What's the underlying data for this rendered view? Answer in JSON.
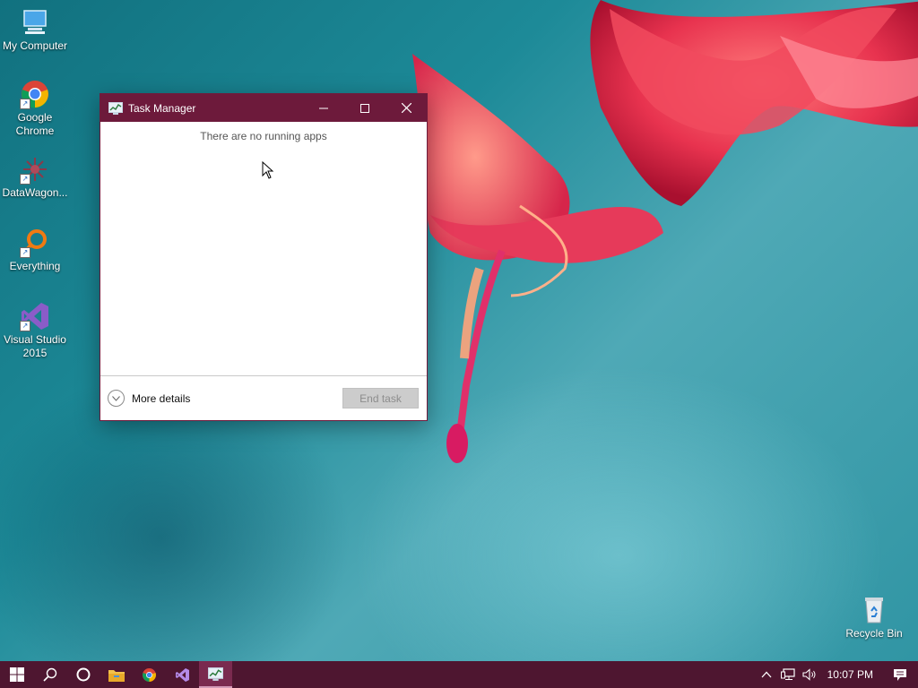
{
  "desktop": {
    "icons": [
      {
        "label": "My Computer",
        "icon": "computer-icon"
      },
      {
        "label": "Google Chrome",
        "icon": "chrome-icon"
      },
      {
        "label": "DataWagon...",
        "icon": "datawagon-icon"
      },
      {
        "label": "Everything",
        "icon": "everything-search-icon"
      },
      {
        "label": "Visual Studio 2015",
        "icon": "visual-studio-icon"
      },
      {
        "label": "Recycle Bin",
        "icon": "recycle-bin-icon"
      }
    ]
  },
  "task_manager": {
    "title": "Task Manager",
    "empty_message": "There are no running apps",
    "more_details_label": "More details",
    "end_task_label": "End task",
    "end_task_enabled": false
  },
  "taskbar": {
    "items": [
      "start-icon",
      "search-icon",
      "cortana-icon",
      "file-explorer-icon",
      "chrome-icon",
      "visual-studio-icon",
      "task-manager-icon"
    ],
    "active_item": "task-manager-icon",
    "clock": "10:07 PM"
  },
  "colors": {
    "titlebar": "#6d1a3b",
    "taskbar": "#4e1630",
    "desktop_accent": "#1d8a98"
  }
}
